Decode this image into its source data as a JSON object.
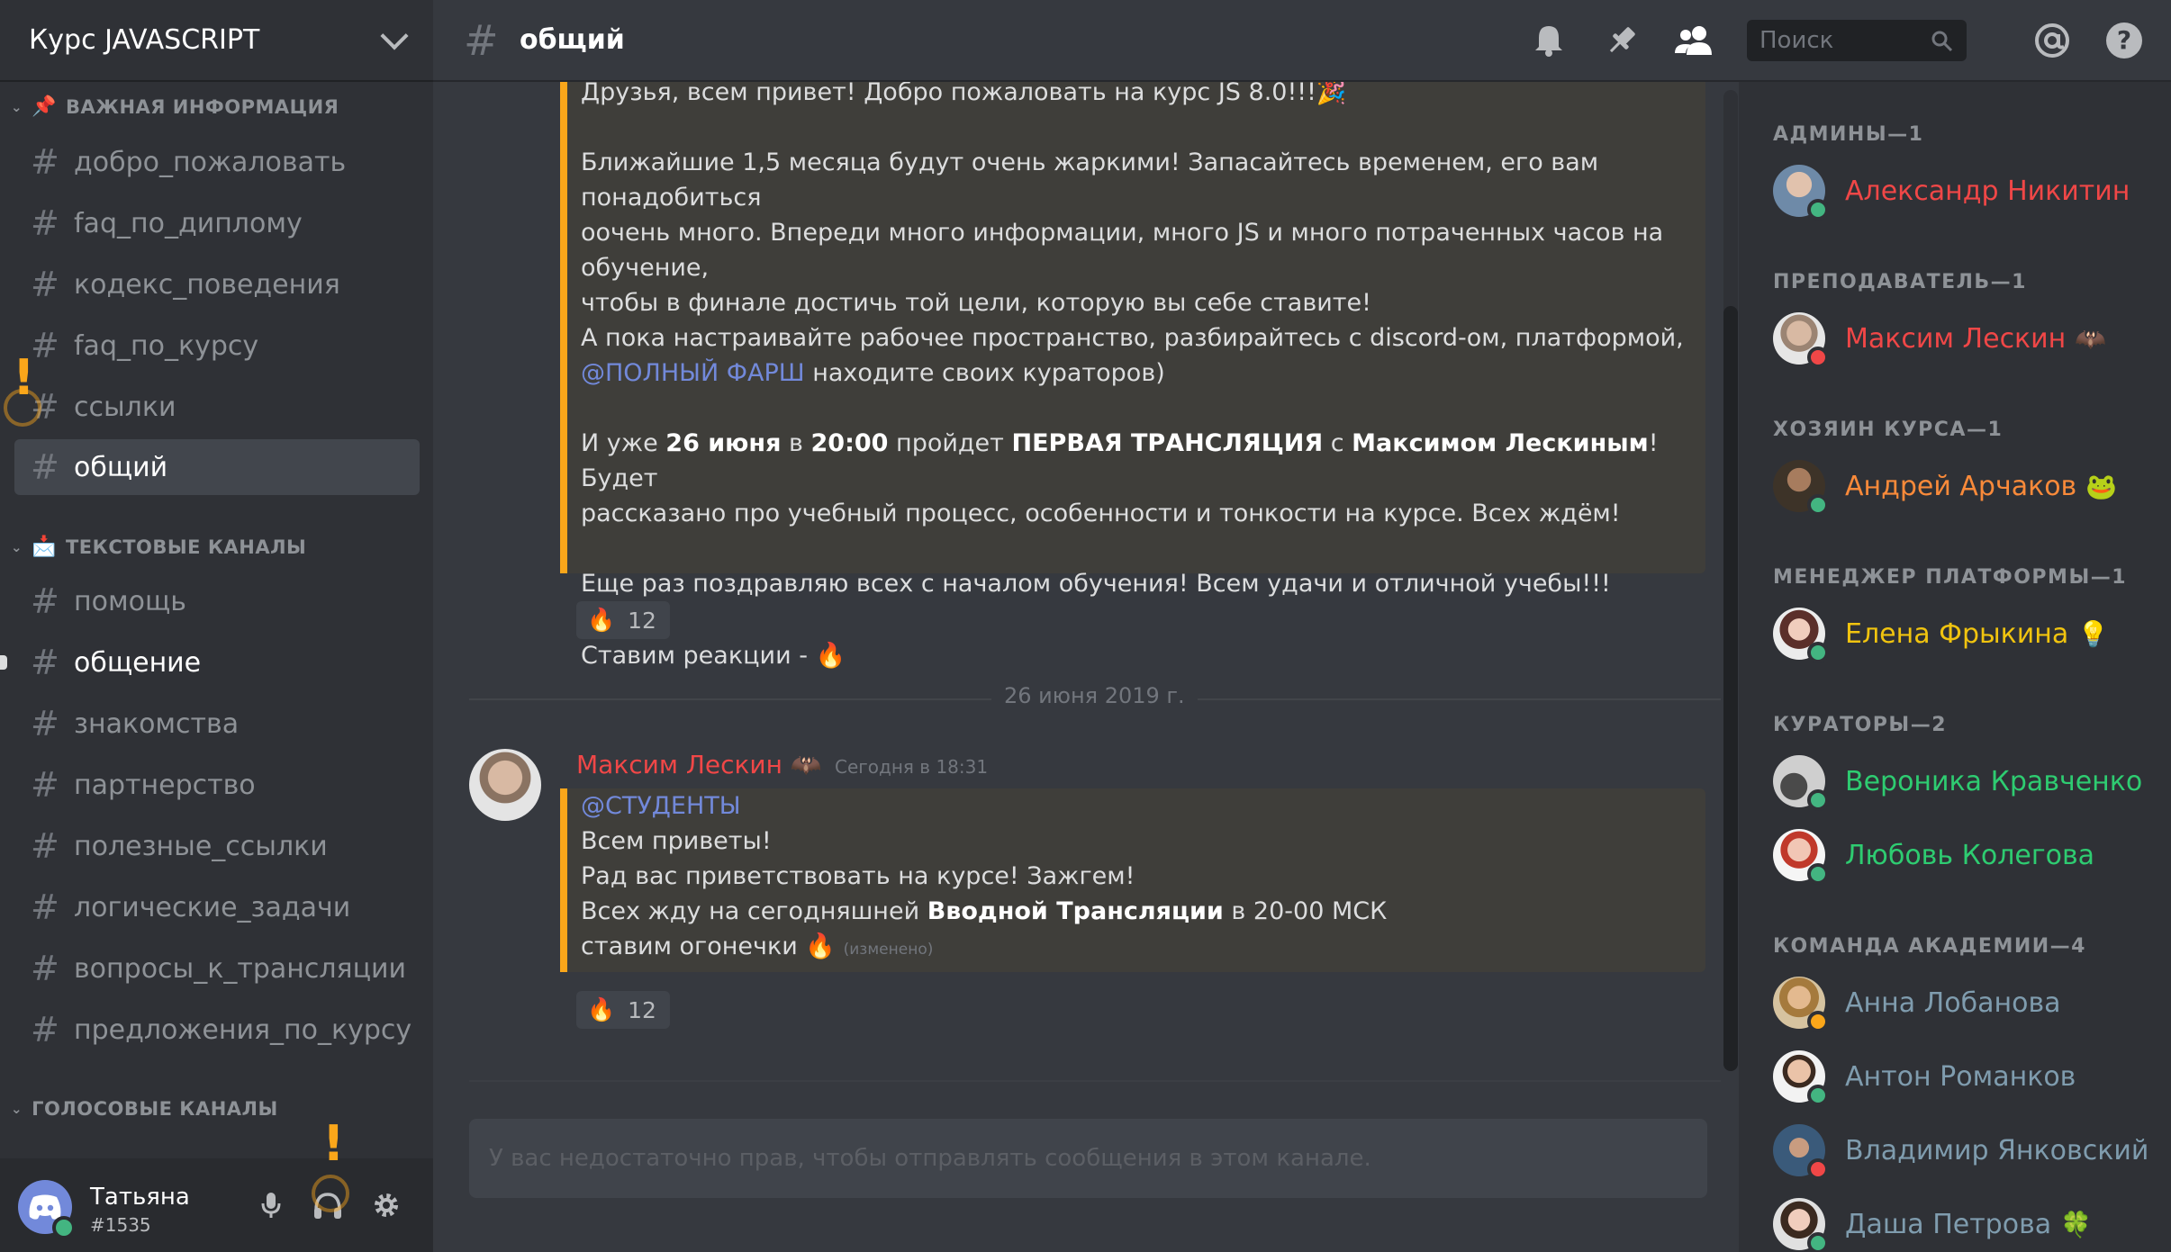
{
  "server": {
    "name": "Курс JAVASCRIPT"
  },
  "sidebar": {
    "categories": [
      {
        "label": "ВАЖНАЯ ИНФОРМАЦИЯ",
        "emoji": "📌"
      },
      {
        "label": "ТЕКСТОВЫЕ КАНАЛЫ",
        "emoji": "📩"
      },
      {
        "label": "ГОЛОСОВЫЕ КАНАЛЫ"
      }
    ],
    "important_channels": [
      "добро_пожаловать",
      "faq_по_диплому",
      "кодекс_поведения",
      "faq_по_курсу",
      "ссылки",
      "общий"
    ],
    "text_channels": [
      "помощь",
      "общение",
      "знакомства",
      "партнерство",
      "полезные_ссылки",
      "логические_задачи",
      "вопросы_к_трансляции",
      "предложения_по_курсу"
    ],
    "active_channel": "общий",
    "hash": "#"
  },
  "user": {
    "name": "Татьяна",
    "tag": "#1535"
  },
  "header": {
    "hash": "#",
    "channel": "общий",
    "search_placeholder": "Поиск"
  },
  "messages": {
    "first_embed": {
      "greeting": "Друзья, всем привет! Добро пожаловать на курс JS 8.0!!!🎉",
      "p2_l1": "Ближайшие 1,5 месяца будут очень жаркими! Запасайтесь временем, его вам понадобиться",
      "p2_l2": "оочень много. Впереди много информации, много JS и много потраченных часов на обучение,",
      "p2_l3": "чтобы в финале достичь той цели, которую вы себе ставите!",
      "p2_l4": "А пока настраивайте рабочее пространство, разбирайтесь с discord-ом, платформой,",
      "p2_mention": "@ПОЛНЫЙ ФАРШ",
      "p2_l5": " находите своих кураторов)",
      "p3_a": "И уже ",
      "p3_date": "26 июня",
      "p3_b": " в ",
      "p3_time": "20:00",
      "p3_c": " пройдет ",
      "p3_event": "ПЕРВАЯ ТРАНСЛЯЦИЯ",
      "p3_d": " с ",
      "p3_host": "Максимом Лескиным",
      "p3_e": "! Будет",
      "p3_l2": "рассказано про учебный процесс, особенности и тонкости на курсе. Всех ждём!",
      "p4": "Еще раз поздравляю всех с началом обучения! Всем удачи и отличной учебы!!!",
      "p5": "Ставим реакции - 🔥"
    },
    "reaction1": {
      "emoji": "🔥",
      "count": "12"
    },
    "date_divider": "26 июня 2019 г.",
    "second": {
      "author": "Максим Лескин",
      "author_badge": "🦇",
      "time": "Сегодня в 18:31",
      "mention": "@СТУДЕНТЫ",
      "l1": "Всем приветы!",
      "l2": "Рад вас приветствовать на курсе! Зажгем!",
      "l3_a": "Всех жду на сегодняшней ",
      "l3_bold": "Вводной Трансляции",
      "l3_b": " в 20-00 МСК",
      "l4": "ставим огонечки 🔥",
      "edited": "(изменено)"
    },
    "reaction2": {
      "emoji": "🔥",
      "count": "12"
    },
    "input_placeholder": "У вас недостаточно прав, чтобы отправлять сообщения в этом канале."
  },
  "members": {
    "roles": [
      {
        "label": "АДМИНЫ—1"
      },
      {
        "label": "ПРЕПОДАВАТЕЛЬ—1"
      },
      {
        "label": "ХОЗЯИН КУРСА—1"
      },
      {
        "label": "МЕНЕДЖЕР ПЛАТФОРМЫ—1"
      },
      {
        "label": "КУРАТОРЫ—2"
      },
      {
        "label": "КОМАНДА АКАДЕМИИ—4"
      }
    ],
    "list": [
      {
        "name": "Александр Никитин",
        "color": "#f04747",
        "status": "online",
        "emoji": ""
      },
      {
        "name": "Максим Лескин",
        "color": "#f04747",
        "status": "dnd",
        "emoji": "🦇"
      },
      {
        "name": "Андрей Арчаков",
        "color": "#f98a3a",
        "status": "online",
        "emoji": "🐸"
      },
      {
        "name": "Елена Фрыкина",
        "color": "#f1c40f",
        "status": "online",
        "emoji": "💡"
      },
      {
        "name": "Вероника Кравченко",
        "color": "#2ecc71",
        "status": "online",
        "emoji": ""
      },
      {
        "name": "Любовь Колегова",
        "color": "#2ecc71",
        "status": "online",
        "emoji": ""
      },
      {
        "name": "Анна Лобанова",
        "color": "#7f9cae",
        "status": "idle",
        "emoji": ""
      },
      {
        "name": "Антон Романков",
        "color": "#7f9cae",
        "status": "online",
        "emoji": ""
      },
      {
        "name": "Владимир Янковский",
        "color": "#7f9cae",
        "status": "dnd",
        "emoji": ""
      },
      {
        "name": "Даша Петрова",
        "color": "#7f9cae",
        "status": "online",
        "emoji": "🍀"
      }
    ]
  },
  "colors": {
    "accent": "#faa61a",
    "online": "#43b581",
    "dnd": "#f04747",
    "idle": "#faa61a",
    "mention": "#7289da"
  }
}
